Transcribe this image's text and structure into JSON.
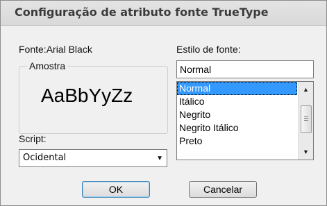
{
  "dialog": {
    "title": "Configuração de atributo fonte TrueType"
  },
  "font": {
    "label": "Fonte:Arial Black",
    "sample_group_label": "Amostra",
    "sample_text": "AaBbYyZz"
  },
  "style": {
    "label": "Estilo de fonte:",
    "value": "Normal",
    "options": [
      "Normal",
      "Itálico",
      "Negrito",
      "Negrito Itálico",
      "Preto"
    ],
    "selected": "Normal"
  },
  "script": {
    "label": "Script:",
    "value": "Ocidental"
  },
  "buttons": {
    "ok": "OK",
    "cancel": "Cancelar"
  },
  "icons": {
    "scroll_up": "up-arrow-icon",
    "scroll_down": "down-arrow-icon",
    "combo": "chevron-down-icon"
  }
}
